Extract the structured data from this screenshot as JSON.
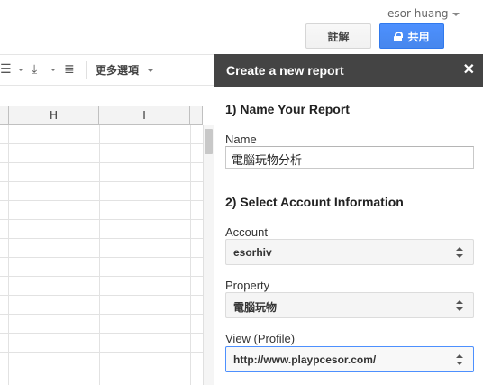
{
  "header": {
    "user": "esor huang",
    "comment_label": "註解",
    "share_label": "共用"
  },
  "toolbar": {
    "more_label": "更多選項",
    "icons": [
      "align-left-icon",
      "valign-bottom-icon",
      "wrap-text-icon"
    ]
  },
  "grid": {
    "columns": [
      "H",
      "I"
    ]
  },
  "sidebar": {
    "title": "Create a new report",
    "section1_title": "1) Name Your Report",
    "name_label": "Name",
    "name_value": "電腦玩物分析",
    "section2_title": "2) Select Account Information",
    "account_label": "Account",
    "account_value": "esorhiv",
    "property_label": "Property",
    "property_value": "電腦玩物",
    "view_label": "View (Profile)",
    "view_value": "http://www.playpcesor.com/"
  },
  "colors": {
    "share_blue": "#4d90fe",
    "sidebar_header": "#444444",
    "focus_border": "#4d90fe"
  }
}
